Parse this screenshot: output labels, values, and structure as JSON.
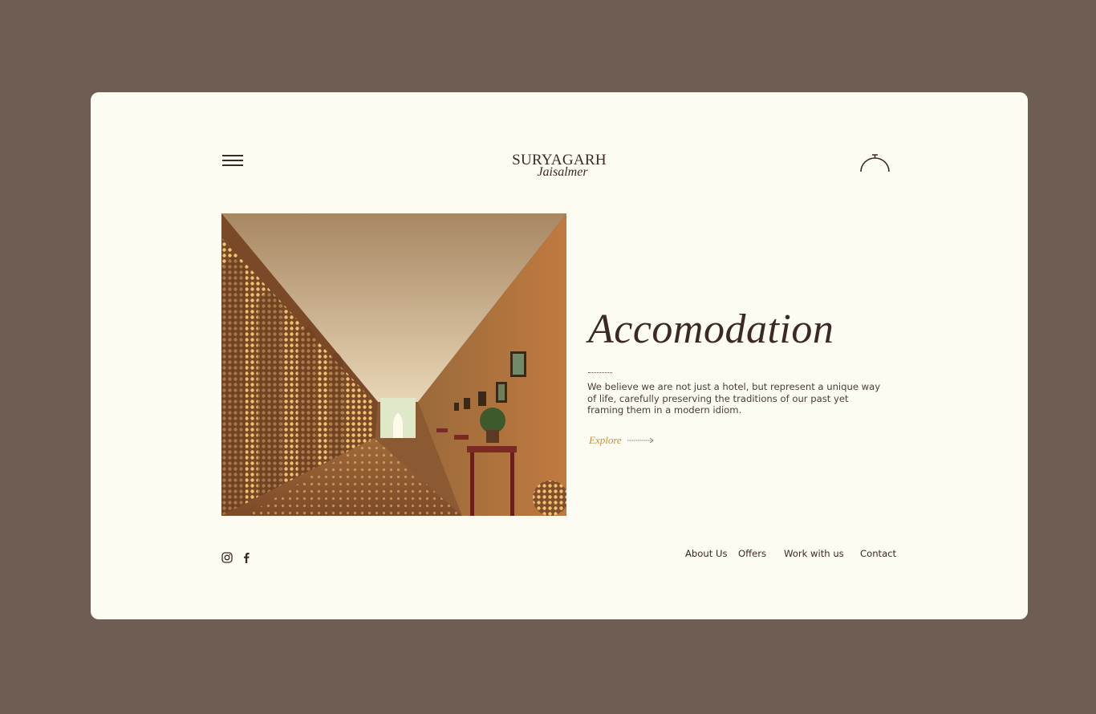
{
  "brand": {
    "name": "SURYAGARH",
    "location": "Jaisalmer"
  },
  "hero": {
    "image_alt": "Arched corridor with lattice stone screens",
    "heading": "Accomodation",
    "description": "We believe we are not just a hotel, but represent a unique way of life, carefully preserving the traditions of our past yet framing them in a modern idiom.",
    "cta_label": "Explore"
  },
  "footer": {
    "social": [
      "instagram-icon",
      "facebook-icon"
    ],
    "nav": [
      "About Us",
      "Offers",
      "Work with us",
      "Contact"
    ]
  },
  "colors": {
    "page_background": "#6e5d53",
    "card_background": "#fcfcf2",
    "text_dark": "#3c2a22",
    "accent_gold": "#c4913e"
  }
}
